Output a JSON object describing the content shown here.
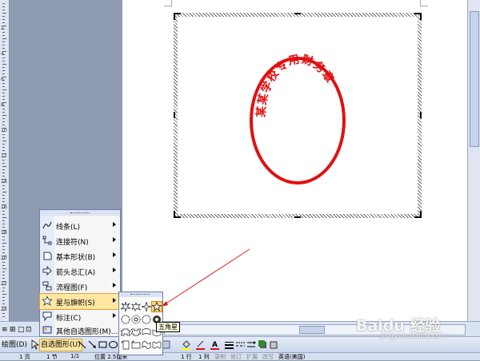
{
  "document": {
    "stamp_text": "某某学校专用财务章"
  },
  "ruler": {
    "numbers": [
      "2",
      "4",
      "6",
      "8",
      "10",
      "12",
      "14",
      "16",
      "18",
      "20",
      "22",
      "24"
    ]
  },
  "view_bar": {
    "labels": [
      "≡",
      "⊞",
      "□",
      "⊡"
    ]
  },
  "drawing_toolbar": {
    "draw_label": "绘图(D)",
    "autoshapes_label": "自选图形(U)"
  },
  "autoshapes_menu": {
    "items": [
      {
        "label": "线条(L)",
        "icon": "lines-icon",
        "submenu": true
      },
      {
        "label": "连接符(N)",
        "icon": "connectors-icon",
        "submenu": true
      },
      {
        "label": "基本形状(B)",
        "icon": "basic-shapes-icon",
        "submenu": true
      },
      {
        "label": "箭头总汇(A)",
        "icon": "block-arrows-icon",
        "submenu": true
      },
      {
        "label": "流程图(F)",
        "icon": "flowchart-icon",
        "submenu": true
      },
      {
        "label": "星与旗帜(S)",
        "icon": "stars-banners-icon",
        "submenu": true,
        "highlighted": true
      },
      {
        "label": "标注(C)",
        "icon": "callouts-icon",
        "submenu": true
      },
      {
        "label": "其他自选图形(M)...",
        "icon": "more-autoshapes-icon",
        "submenu": false
      }
    ]
  },
  "stars_submenu": {
    "selected": "five-point-star",
    "tooltip": "五角星"
  },
  "statusbar": {
    "page": "1 页",
    "section": "1 节",
    "pages": "1/1",
    "position": "位置 2.5厘米",
    "line": "1 行",
    "col": "1 列",
    "modes": [
      "录制",
      "修订",
      "扩展",
      "改写"
    ],
    "language": "英语(美国)"
  },
  "watermark": {
    "brand": "Baidu 经验",
    "url": "jingyan.baidu.com"
  },
  "colors": {
    "stamp_red": "#e01010",
    "menu_highlight": "#ffe7a2",
    "toolbar_blue": "#dae3f3",
    "workspace_gray": "#8f9bb1"
  }
}
